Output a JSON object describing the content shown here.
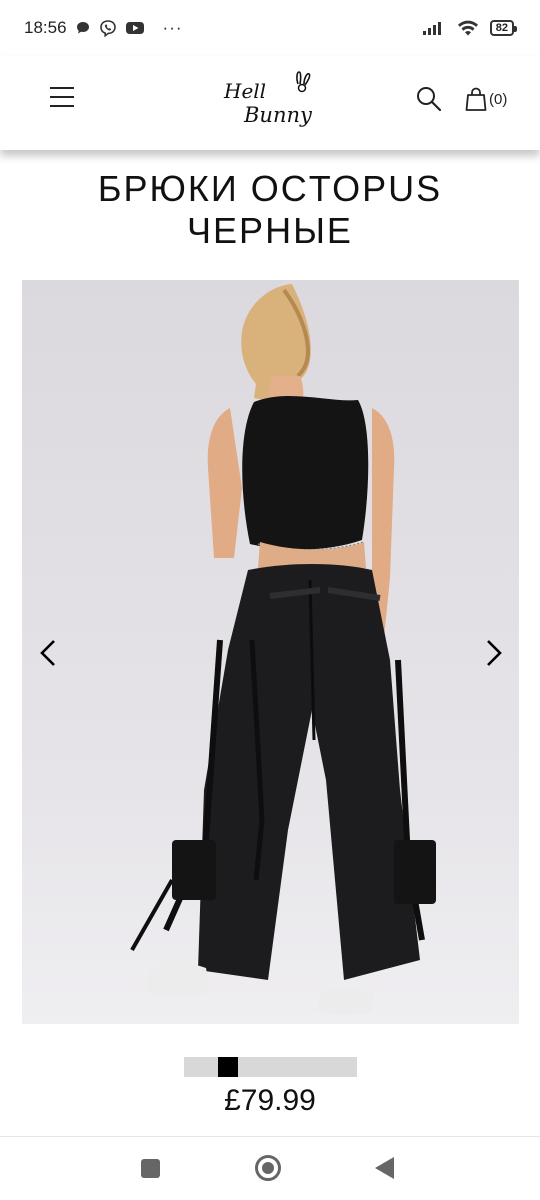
{
  "status_bar": {
    "time": "18:56",
    "notification_icons": [
      "chat-icon",
      "viber-icon",
      "youtube-icon"
    ],
    "more": "···",
    "battery": "82"
  },
  "header": {
    "brand": "Hell Bunny",
    "brand_line1": "Hell",
    "brand_line2": "Bunny",
    "cart_count": "(0)"
  },
  "product": {
    "title_line1": "БРЮКИ OCTOPUS",
    "title_line2": "ЧЕРНЫЕ",
    "price": "£79.99"
  },
  "gallery": {
    "slide_position": 0.22
  },
  "colors": {
    "accent": "#000000",
    "background": "#ffffff",
    "photo_bg": "#e4e2e6"
  }
}
